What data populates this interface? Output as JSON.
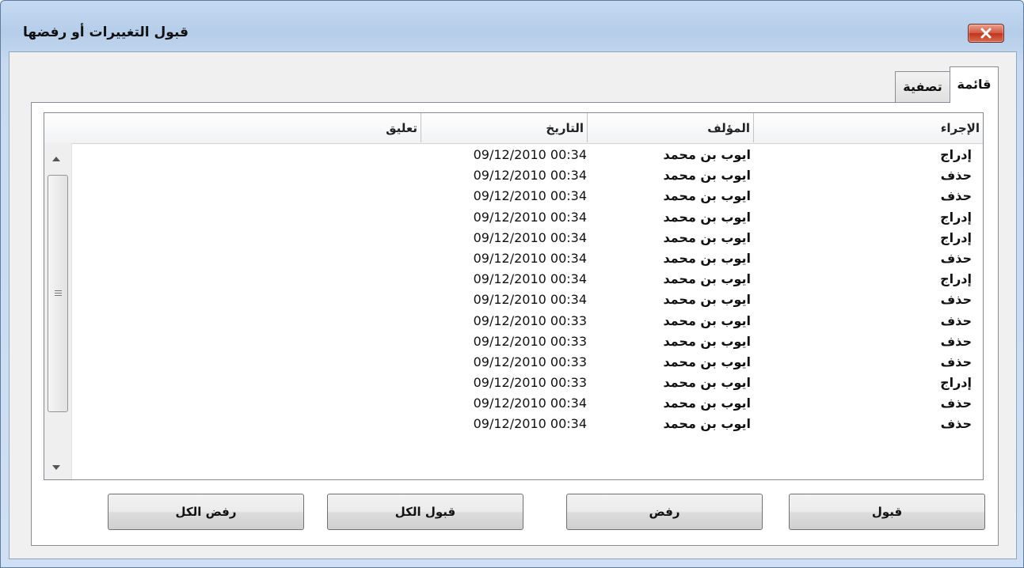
{
  "window": {
    "title": "قبول التغييرات أو رفضها"
  },
  "tabs": [
    {
      "label": "قائمة"
    },
    {
      "label": "تصفية"
    }
  ],
  "table": {
    "columns": {
      "action": "الإجراء",
      "author": "المؤلف",
      "date": "التاريخ",
      "comment": "تعليق"
    },
    "rows": [
      {
        "action": "إدراج",
        "author": "ايوب بن محمد",
        "date": "09/12/2010 00:34",
        "comment": ""
      },
      {
        "action": "حذف",
        "author": "ايوب بن محمد",
        "date": "09/12/2010 00:34",
        "comment": ""
      },
      {
        "action": "حذف",
        "author": "ايوب بن محمد",
        "date": "09/12/2010 00:34",
        "comment": ""
      },
      {
        "action": "إدراج",
        "author": "ايوب بن محمد",
        "date": "09/12/2010 00:34",
        "comment": ""
      },
      {
        "action": "إدراج",
        "author": "ايوب بن محمد",
        "date": "09/12/2010 00:34",
        "comment": ""
      },
      {
        "action": "حذف",
        "author": "ايوب بن محمد",
        "date": "09/12/2010 00:34",
        "comment": ""
      },
      {
        "action": "إدراج",
        "author": "ايوب بن محمد",
        "date": "09/12/2010 00:34",
        "comment": ""
      },
      {
        "action": "حذف",
        "author": "ايوب بن محمد",
        "date": "09/12/2010 00:34",
        "comment": ""
      },
      {
        "action": "حذف",
        "author": "ايوب بن محمد",
        "date": "09/12/2010 00:33",
        "comment": ""
      },
      {
        "action": "حذف",
        "author": "ايوب بن محمد",
        "date": "09/12/2010 00:33",
        "comment": ""
      },
      {
        "action": "حذف",
        "author": "ايوب بن محمد",
        "date": "09/12/2010 00:33",
        "comment": ""
      },
      {
        "action": "إدراج",
        "author": "ايوب بن محمد",
        "date": "09/12/2010 00:33",
        "comment": ""
      },
      {
        "action": "حذف",
        "author": "ايوب بن محمد",
        "date": "09/12/2010 00:34",
        "comment": ""
      },
      {
        "action": "حذف",
        "author": "ايوب بن محمد",
        "date": "09/12/2010 00:34",
        "comment": ""
      }
    ]
  },
  "buttons": {
    "accept": "قبول",
    "reject": "رفض",
    "accept_all": "قبول الكل",
    "reject_all": "رفض الكل"
  },
  "icons": {
    "close": "close-icon",
    "scroll_up": "arrow-up-icon",
    "scroll_down": "arrow-down-icon"
  }
}
